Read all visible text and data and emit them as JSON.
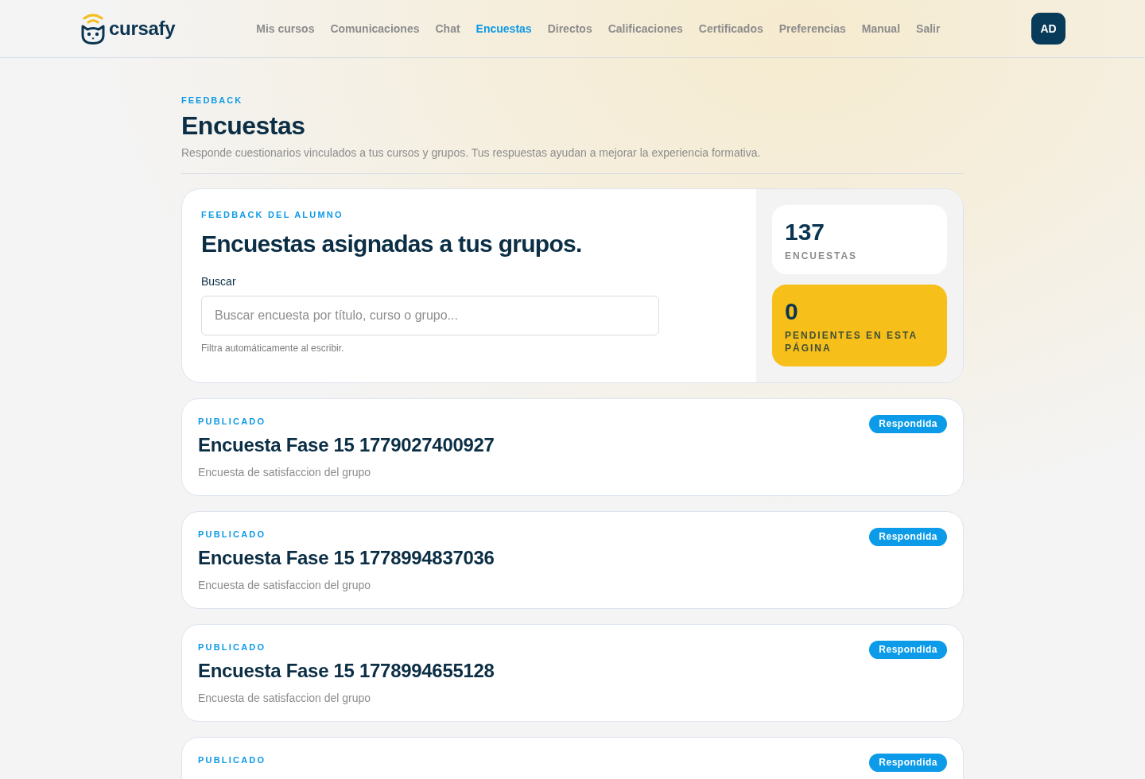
{
  "header": {
    "logo_text": "cursafy",
    "nav": [
      {
        "label": "Mis cursos",
        "selected": false
      },
      {
        "label": "Comunicaciones",
        "selected": false
      },
      {
        "label": "Chat",
        "selected": false
      },
      {
        "label": "Encuestas",
        "selected": true
      },
      {
        "label": "Directos",
        "selected": false
      },
      {
        "label": "Calificaciones",
        "selected": false
      },
      {
        "label": "Certificados",
        "selected": false
      },
      {
        "label": "Preferencias",
        "selected": false
      },
      {
        "label": "Manual",
        "selected": false
      },
      {
        "label": "Salir",
        "selected": false
      }
    ],
    "avatar": "AD"
  },
  "page": {
    "eyebrow": "FEEDBACK",
    "title": "Encuestas",
    "subtitle": "Responde cuestionarios vinculados a tus cursos y grupos. Tus respuestas ayudan a mejorar la experiencia formativa."
  },
  "hero": {
    "eyebrow": "FEEDBACK DEL ALUMNO",
    "title": "Encuestas asignadas a tus grupos.",
    "search": {
      "label": "Buscar",
      "placeholder": "Buscar encuesta por título, curso o grupo...",
      "hint": "Filtra automáticamente al escribir."
    },
    "stats": [
      {
        "kind": "plain",
        "value": "137",
        "label": "ENCUESTAS"
      },
      {
        "kind": "highlight",
        "value": "0",
        "label": "PENDIENTES EN ESTA PÁGINA"
      }
    ]
  },
  "surveys": [
    {
      "status": "PUBLICADO",
      "title": "Encuesta Fase 15 1779027400927",
      "description": "Encuesta de satisfaccion del grupo",
      "badge": "Respondida"
    },
    {
      "status": "PUBLICADO",
      "title": "Encuesta Fase 15 1778994837036",
      "description": "Encuesta de satisfaccion del grupo",
      "badge": "Respondida"
    },
    {
      "status": "PUBLICADO",
      "title": "Encuesta Fase 15 1778994655128",
      "description": "Encuesta de satisfaccion del grupo",
      "badge": "Respondida"
    },
    {
      "status": "PUBLICADO",
      "badge": "Respondida"
    }
  ]
}
